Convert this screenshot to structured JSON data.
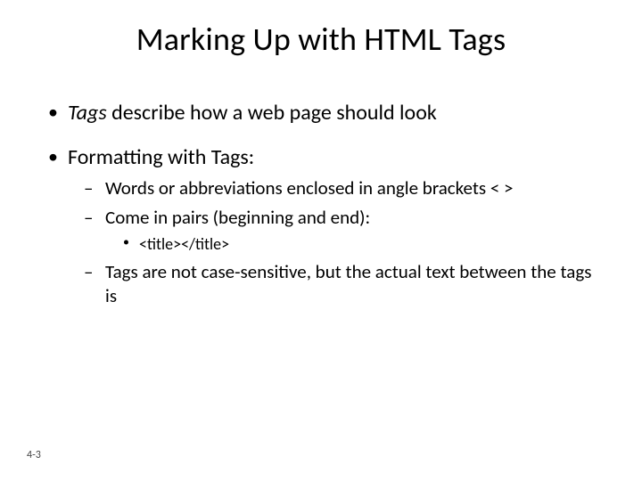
{
  "title": "Marking Up with HTML Tags",
  "bullets": {
    "b1_italic": "Tags",
    "b1_rest": " describe how a web page should look",
    "b2": "Formatting with Tags:",
    "b2_sub1": "Words or abbreviations enclosed in angle brackets < >",
    "b2_sub2": "Come in pairs (beginning and end):",
    "b2_sub2_sub1": "<title></title>",
    "b2_sub3": "Tags are not case-sensitive, but the actual text between the tags is"
  },
  "footer": "4-3"
}
